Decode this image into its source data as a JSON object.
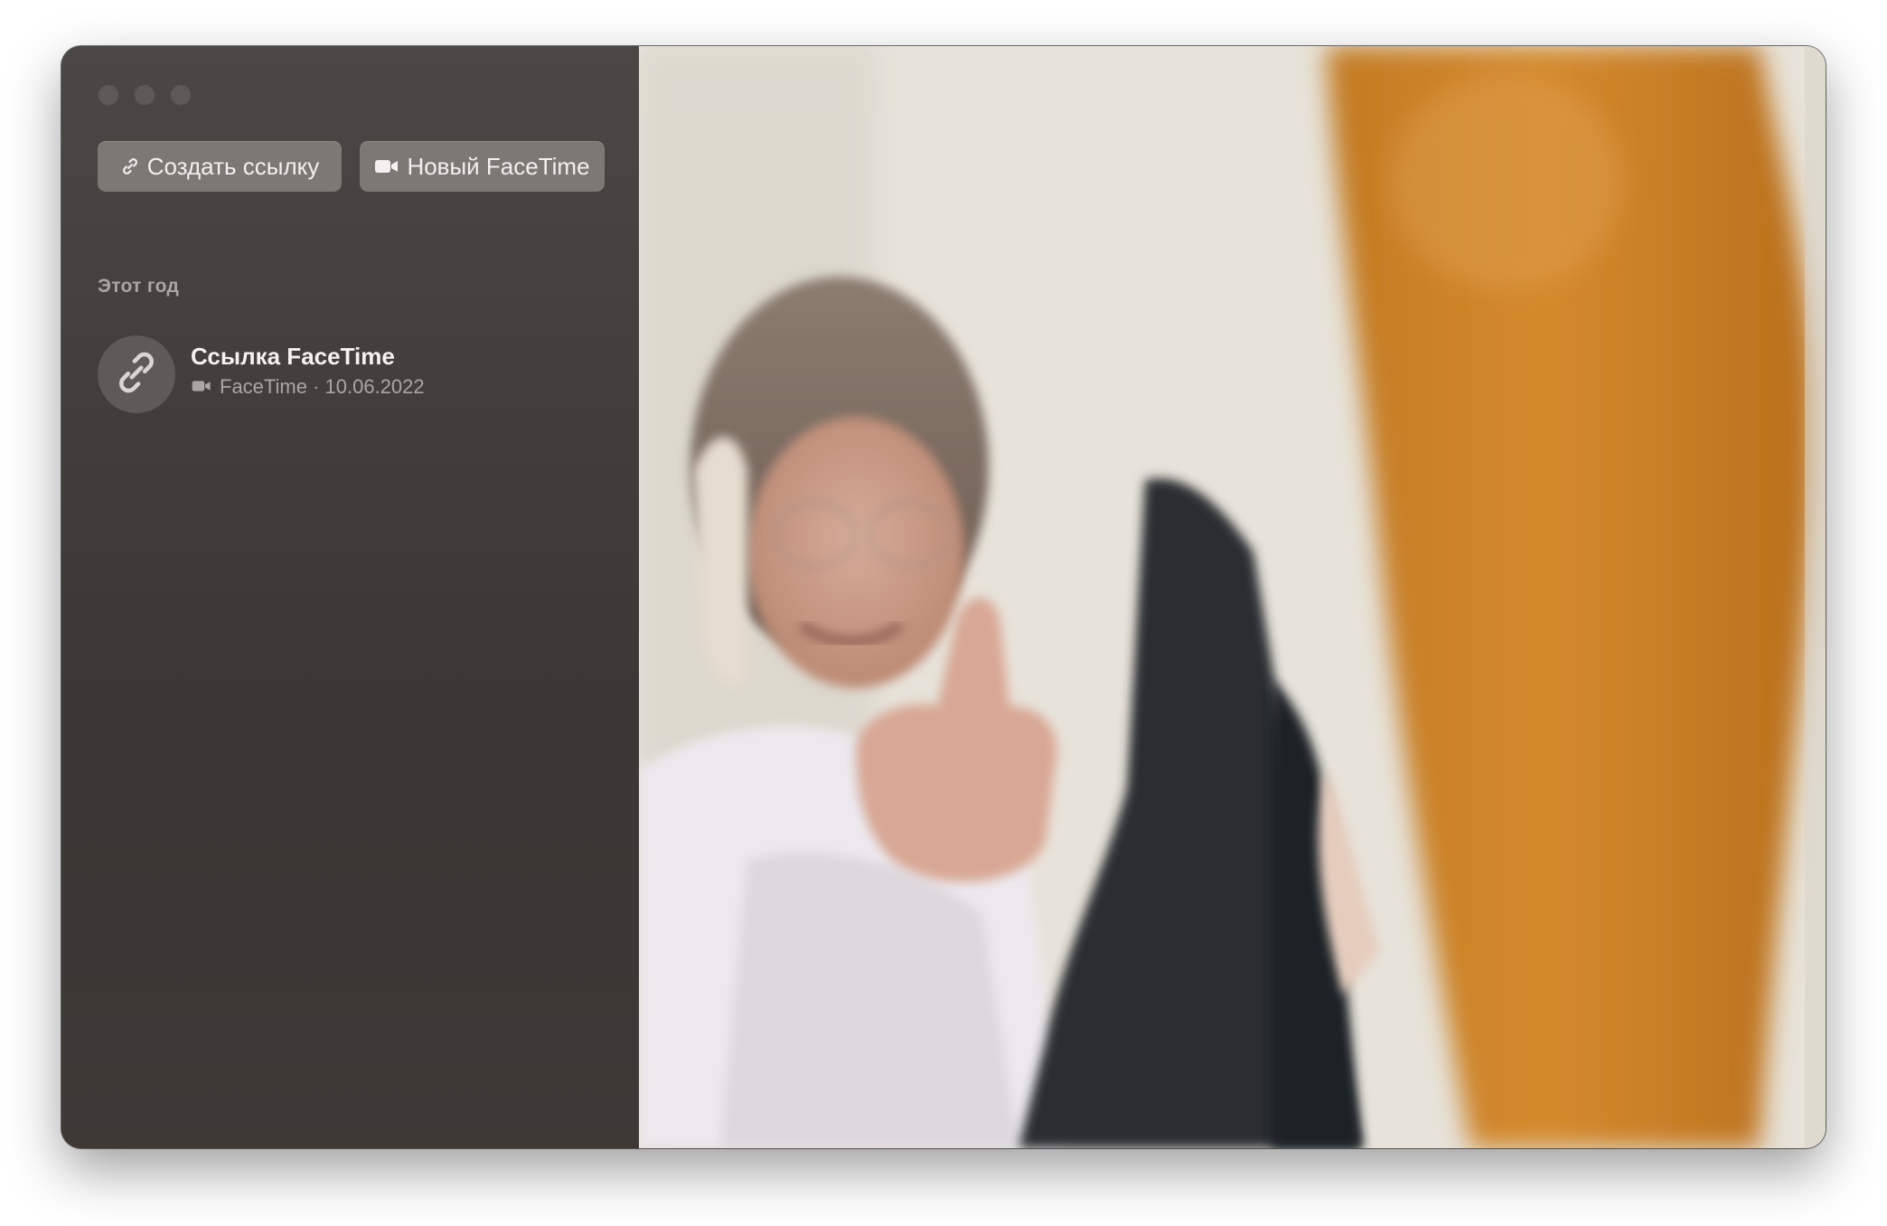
{
  "window": {
    "traffic_lights": [
      "close",
      "minimize",
      "zoom"
    ]
  },
  "toolbar": {
    "create_link_label": "Создать ссылку",
    "create_link_icon": "link-icon",
    "new_facetime_label": "Новый FaceTime",
    "new_facetime_icon": "video-camera-icon"
  },
  "recents": {
    "section_title": "Этот год",
    "items": [
      {
        "title": "Ссылка FaceTime",
        "icon": "link-icon",
        "subtitle_icon": "video-camera-icon",
        "subtitle": "FaceTime · 10.06.2022"
      }
    ]
  },
  "colors": {
    "sidebar_bg": "#3a3835",
    "button_bg": "#7b7974",
    "text_primary": "#f3f2f0",
    "text_secondary": "#a9a7a3"
  }
}
